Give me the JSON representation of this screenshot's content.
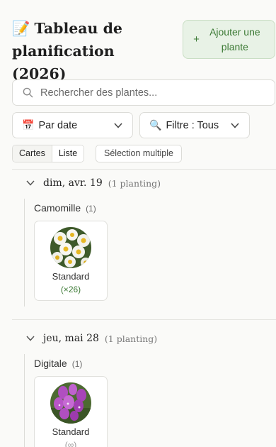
{
  "header": {
    "title_icon": "memo-emoji",
    "title": "Tableau de planification (2026)",
    "add_button_icon": "plus-icon",
    "add_button_label": "Ajouter une plante"
  },
  "search": {
    "icon": "search-icon",
    "placeholder": "Rechercher des plantes..."
  },
  "sort_select": {
    "icon": "📅",
    "label": "Par date"
  },
  "filter_select": {
    "icon": "🔍",
    "label": "Filtre : Tous"
  },
  "view_toggle": {
    "options": [
      "Cartes",
      "Liste"
    ],
    "selected": "Cartes"
  },
  "multi_select_label": "Sélection multiple",
  "groups": [
    {
      "date": "dim, avr. 19",
      "count": "(1 planting)",
      "plants": [
        {
          "name": "Camomille",
          "count": "(1)",
          "cards": [
            {
              "type": "Standard",
              "qty": "(×26)",
              "image": "chamomile-photo"
            }
          ]
        }
      ]
    },
    {
      "date": "jeu, mai 28",
      "count": "(1 planting)",
      "plants": [
        {
          "name": "Digitale",
          "count": "(1)",
          "cards": [
            {
              "type": "Standard",
              "qty": "(∞)",
              "image": "foxglove-photo"
            }
          ]
        }
      ]
    }
  ],
  "colors": {
    "accent_green": "#3c7a35",
    "add_button_bg": "#e8f2e6",
    "border": "#dcdcd8",
    "background": "#fafaf8"
  }
}
